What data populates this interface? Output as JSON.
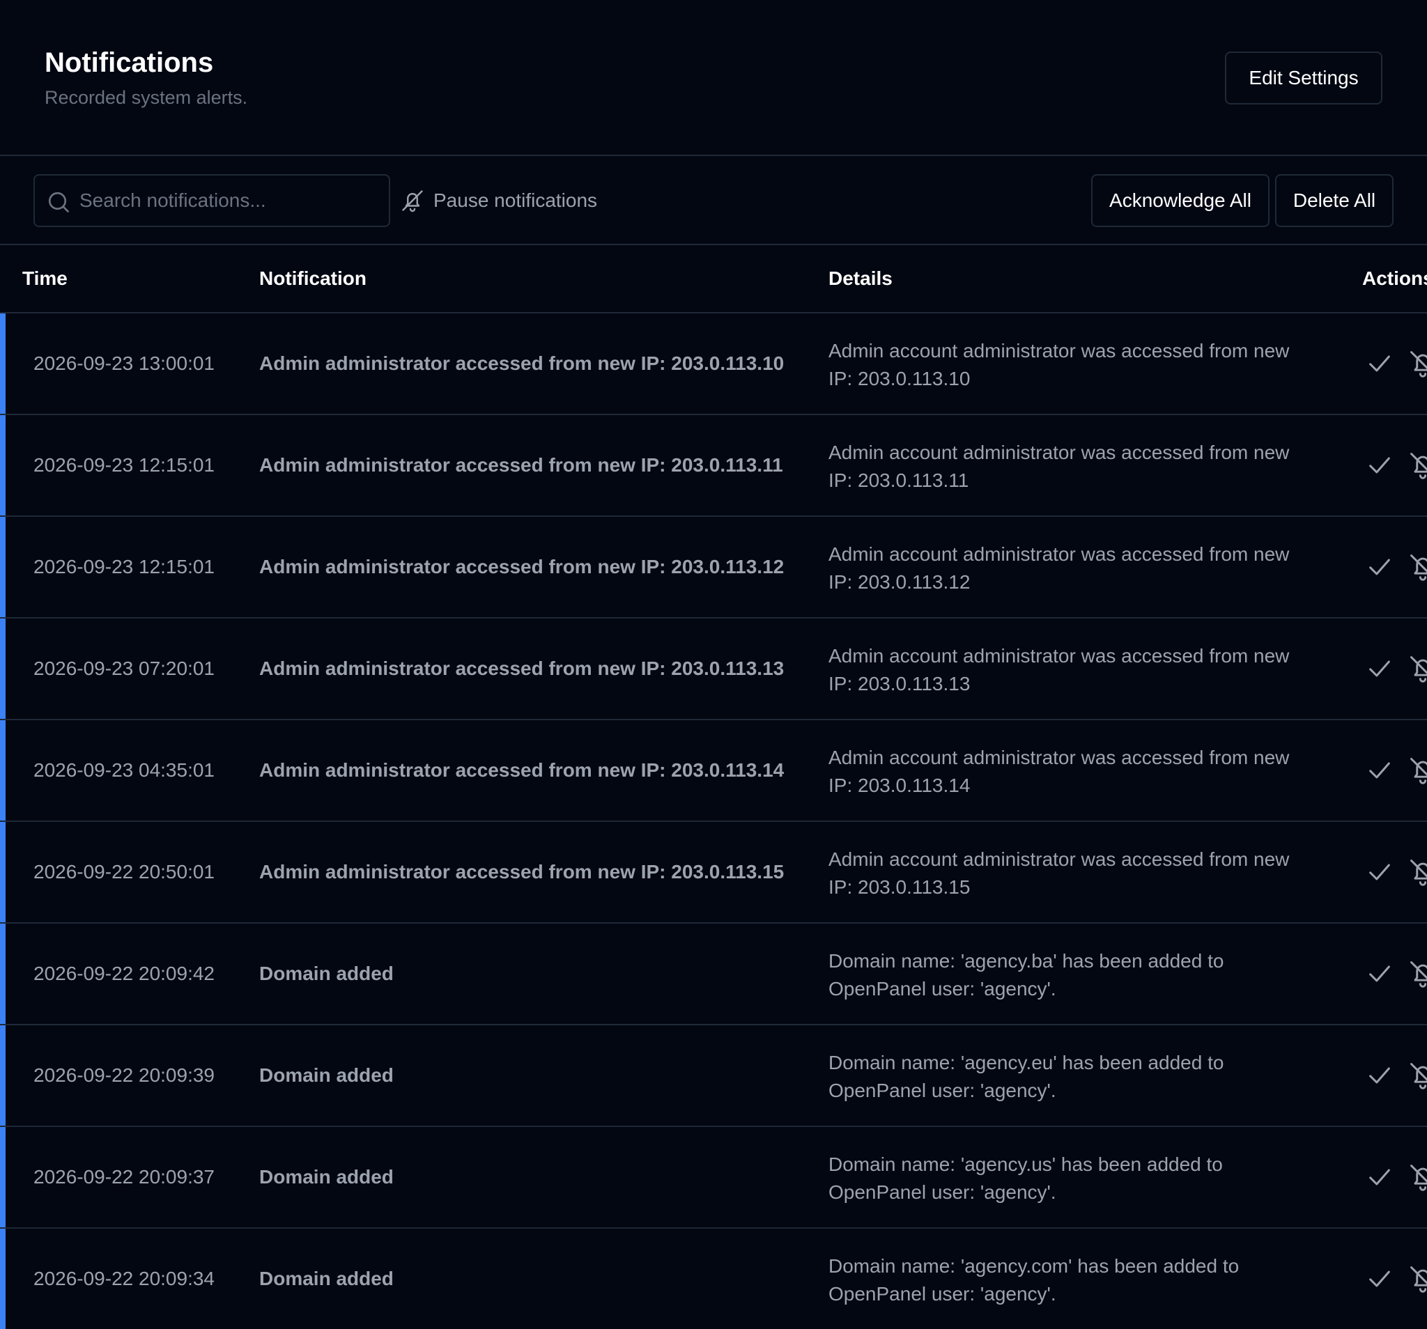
{
  "header": {
    "title": "Notifications",
    "subtitle": "Recorded system alerts.",
    "edit_settings_label": "Edit Settings"
  },
  "toolbar": {
    "search_placeholder": "Search notifications...",
    "search_value": "",
    "pause_label": "Pause notifications",
    "acknowledge_all_label": "Acknowledge All",
    "delete_all_label": "Delete All"
  },
  "table": {
    "columns": {
      "time": "Time",
      "notification": "Notification",
      "details": "Details",
      "actions": "Actions"
    },
    "rows": [
      {
        "time": "2026-09-23 13:00:01",
        "title": "Admin administrator accessed from new IP: 203.0.113.10",
        "details": "Admin account administrator was accessed from new IP: 203.0.113.10"
      },
      {
        "time": "2026-09-23 12:15:01",
        "title": "Admin administrator accessed from new IP: 203.0.113.11",
        "details": "Admin account administrator was accessed from new IP: 203.0.113.11"
      },
      {
        "time": "2026-09-23 12:15:01",
        "title": "Admin administrator accessed from new IP: 203.0.113.12",
        "details": "Admin account administrator was accessed from new IP: 203.0.113.12"
      },
      {
        "time": "2026-09-23 07:20:01",
        "title": "Admin administrator accessed from new IP: 203.0.113.13",
        "details": "Admin account administrator was accessed from new IP: 203.0.113.13"
      },
      {
        "time": "2026-09-23 04:35:01",
        "title": "Admin administrator accessed from new IP: 203.0.113.14",
        "details": "Admin account administrator was accessed from new IP: 203.0.113.14"
      },
      {
        "time": "2026-09-22 20:50:01",
        "title": "Admin administrator accessed from new IP: 203.0.113.15",
        "details": "Admin account administrator was accessed from new IP: 203.0.113.15"
      },
      {
        "time": "2026-09-22 20:09:42",
        "title": "Domain added",
        "details": "Domain name: 'agency.ba' has been added to OpenPanel user: 'agency'."
      },
      {
        "time": "2026-09-22 20:09:39",
        "title": "Domain added",
        "details": "Domain name: 'agency.eu' has been added to OpenPanel user: 'agency'."
      },
      {
        "time": "2026-09-22 20:09:37",
        "title": "Domain added",
        "details": "Domain name: 'agency.us' has been added to OpenPanel user: 'agency'."
      },
      {
        "time": "2026-09-22 20:09:34",
        "title": "Domain added",
        "details": "Domain name: 'agency.com' has been added to OpenPanel user: 'agency'."
      }
    ]
  },
  "icons": {
    "search": "search-icon",
    "pause": "bell-off-icon",
    "acknowledge": "check-icon",
    "mute": "bell-off-icon"
  },
  "colors": {
    "background": "#030712",
    "border": "#1f2937",
    "accent": "#3b82f6",
    "muted_text": "#9ca3af"
  }
}
